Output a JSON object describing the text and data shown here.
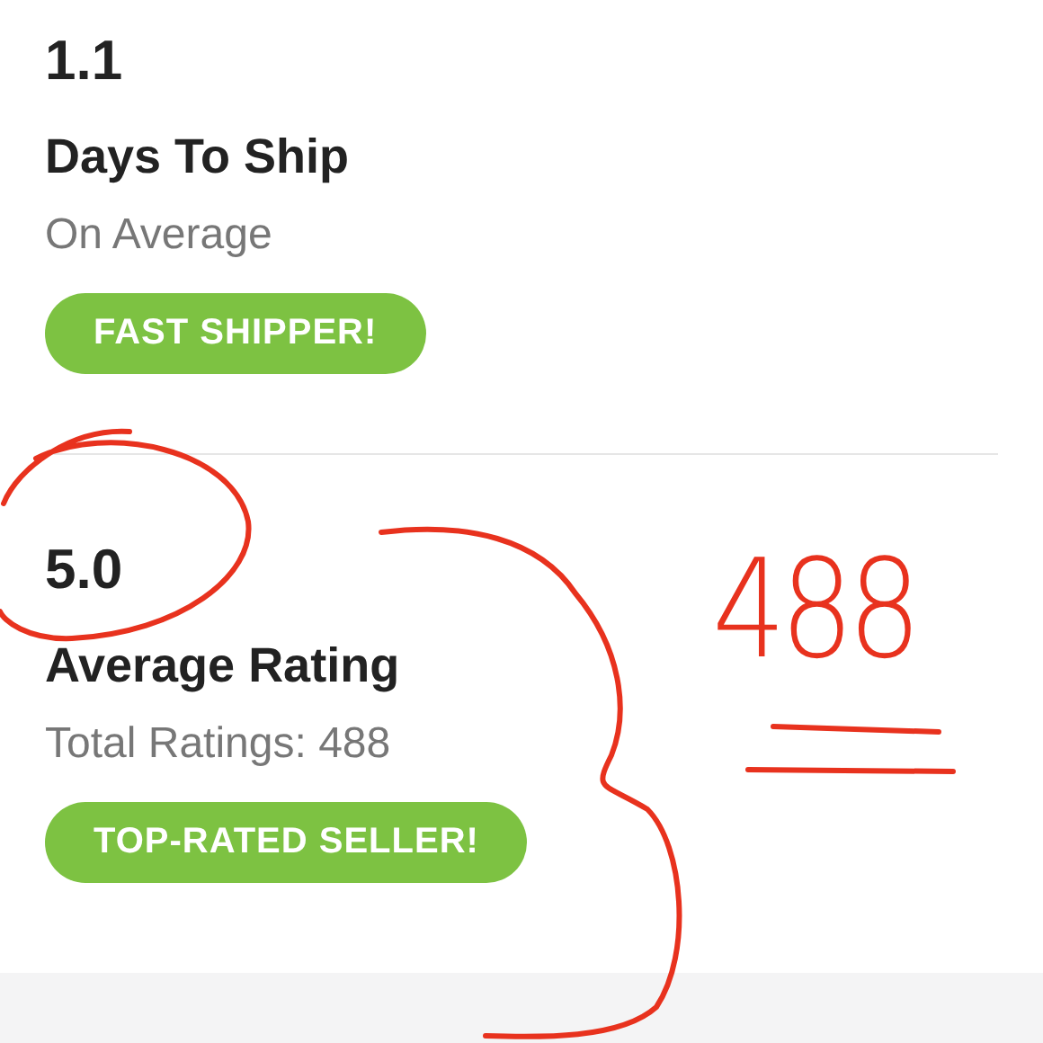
{
  "stats": [
    {
      "value": "1.1",
      "title": "Days To Ship",
      "subtitle": "On Average",
      "badge": "FAST SHIPPER!"
    },
    {
      "value": "5.0",
      "title": "Average Rating",
      "subtitle": "Total Ratings: 488",
      "badge": "TOP-RATED SELLER!"
    }
  ],
  "annotation": {
    "note": "488"
  }
}
